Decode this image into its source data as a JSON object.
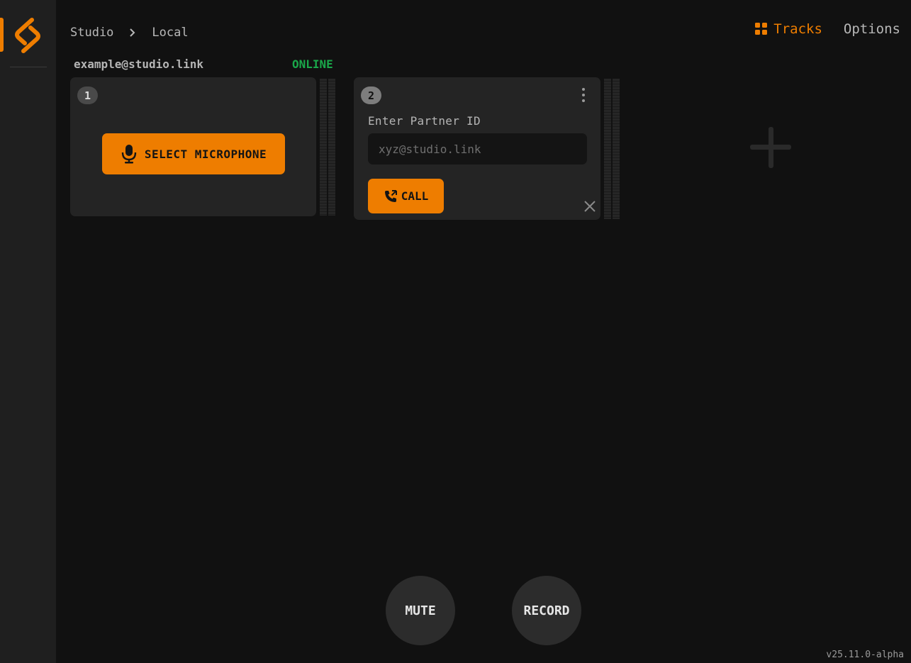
{
  "app": {
    "accent_color": "#ee7d00",
    "online_color": "#1aa84a"
  },
  "breadcrumb": {
    "items": [
      "Studio",
      "Local"
    ]
  },
  "nav": {
    "tracks_label": "Tracks",
    "options_label": "Options"
  },
  "identity": {
    "id": "example@studio.link",
    "status": "ONLINE"
  },
  "tracks": [
    {
      "number": "1",
      "select_mic_label": "SELECT MICROPHONE"
    },
    {
      "number": "2",
      "partner_label": "Enter Partner ID",
      "partner_placeholder": "xyz@studio.link",
      "partner_value": "",
      "call_label": "CALL"
    }
  ],
  "controls": {
    "mute_label": "MUTE",
    "record_label": "RECORD"
  },
  "version": "v25.11.0-alpha",
  "icons": {
    "logo": "studio-link-logo",
    "breadcrumb_separator": "chevron-right-icon",
    "tracks": "grid-icon",
    "mic": "microphone-icon",
    "call": "phone-forward-icon",
    "menu": "kebab-menu-icon",
    "close": "close-icon",
    "add": "plus-icon"
  }
}
